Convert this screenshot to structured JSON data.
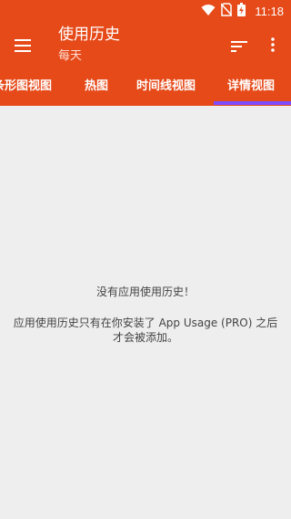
{
  "status_bar": {
    "time": "11:18",
    "icons": [
      "wifi-icon",
      "no-sim-icon",
      "battery-charging-icon"
    ]
  },
  "app_bar": {
    "title": "使用历史",
    "subtitle": "每天",
    "menu_icon": "hamburger-menu-icon",
    "sort_icon": "sort-icon",
    "more_icon": "more-vert-icon"
  },
  "tabs": [
    {
      "label": "条形图视图"
    },
    {
      "label": "热图"
    },
    {
      "label": "时间线视图"
    },
    {
      "label": "详情视图",
      "selected": true
    }
  ],
  "colors": {
    "primary": "#e64a19",
    "indicator": "#7c4dff",
    "background": "#eeeeee"
  },
  "empty_state": {
    "title": "没有应用使用历史！",
    "description": "应用使用历史只有在你安装了 App Usage (PRO) 之后才会被添加。"
  }
}
